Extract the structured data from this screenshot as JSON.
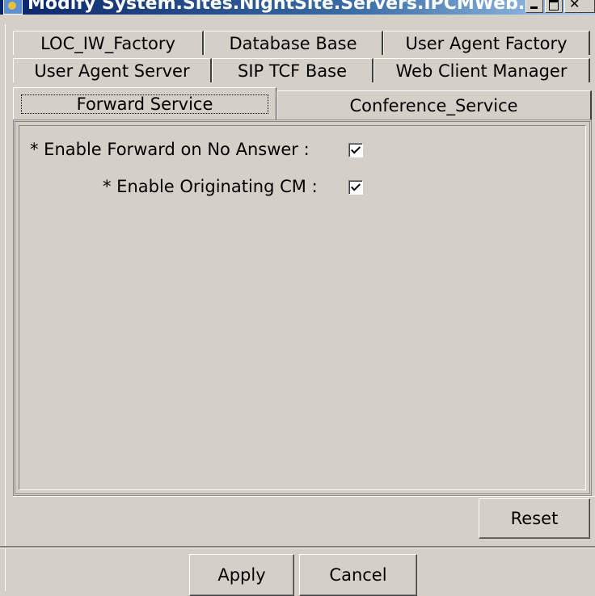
{
  "window": {
    "title": "Modify System.Sites.NightSite.Servers.IPCMWeb...."
  },
  "tabs": {
    "row1": [
      "LOC_IW_Factory",
      "Database Base",
      "User Agent Factory"
    ],
    "row2": [
      "User Agent Server",
      "SIP TCF Base",
      "Web Client Manager"
    ],
    "row3": [
      "Forward Service",
      "Conference_Service"
    ],
    "selected": "Forward Service"
  },
  "form": {
    "fields": [
      {
        "label": "* Enable Forward on No Answer :",
        "checked": true
      },
      {
        "label": "* Enable Originating CM :",
        "checked": true
      }
    ],
    "reset_label": "Reset"
  },
  "footer": {
    "apply_label": "Apply",
    "cancel_label": "Cancel"
  },
  "colors": {
    "face": "#d4d0c8",
    "title_active": "#0a246a"
  }
}
